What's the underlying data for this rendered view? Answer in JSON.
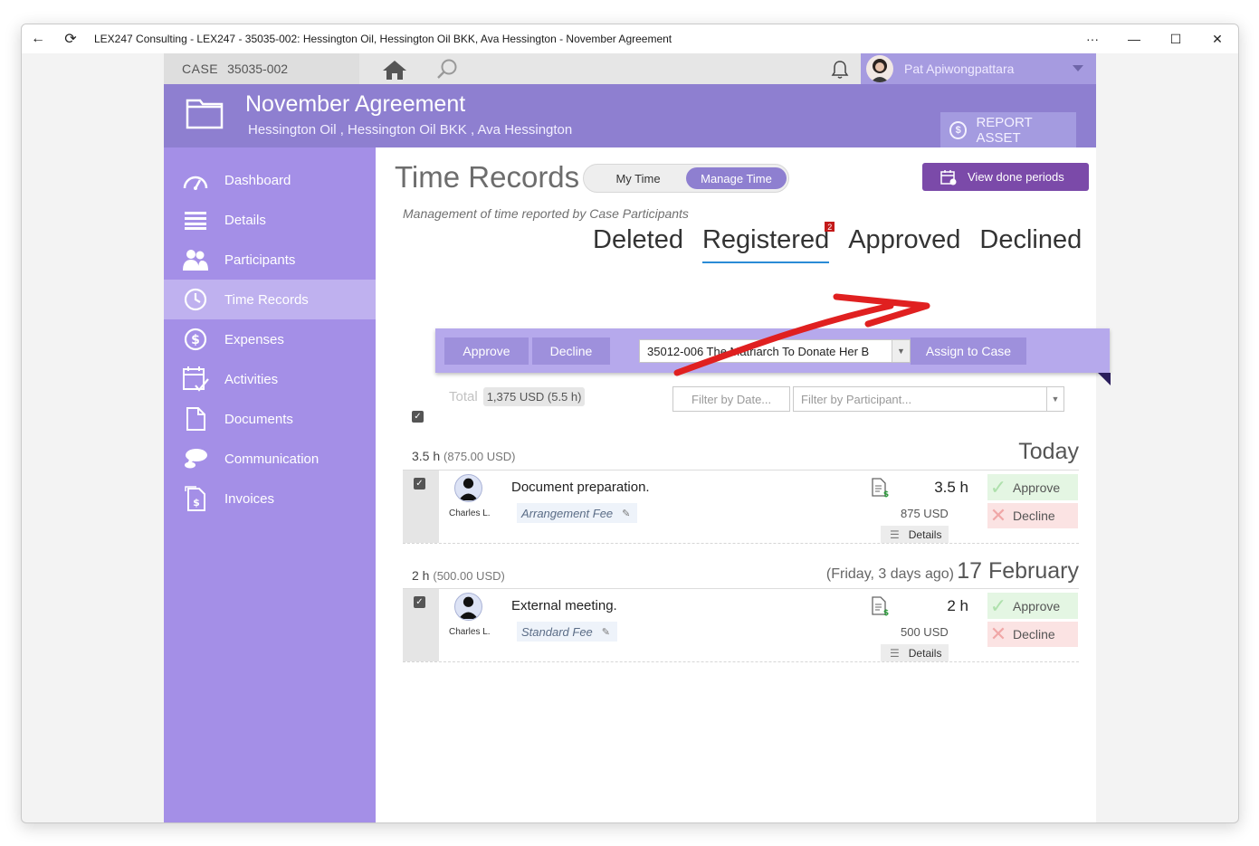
{
  "window": {
    "title": "LEX247 Consulting - LEX247 - 35035-002: Hessington Oil, Hessington Oil BKK, Ava Hessington - November Agreement",
    "more_label": "···"
  },
  "topbar": {
    "case_label": "CASE",
    "case_number": "35035-002",
    "user_name": "Pat Apiwongpattara"
  },
  "header": {
    "title": "November Agreement",
    "subtitle": "Hessington Oil ,  Hessington Oil BKK ,  Ava Hessington",
    "report_asset_label": "REPORT ASSET"
  },
  "sidebar": {
    "items": [
      {
        "label": "Dashboard",
        "icon": "dashboard-icon"
      },
      {
        "label": "Details",
        "icon": "list-icon"
      },
      {
        "label": "Participants",
        "icon": "people-icon"
      },
      {
        "label": "Time Records",
        "icon": "clock-icon",
        "active": true
      },
      {
        "label": "Expenses",
        "icon": "dollar-icon"
      },
      {
        "label": "Activities",
        "icon": "calendar-check-icon"
      },
      {
        "label": "Documents",
        "icon": "document-icon"
      },
      {
        "label": "Communication",
        "icon": "chat-icon"
      },
      {
        "label": "Invoices",
        "icon": "invoice-icon"
      }
    ]
  },
  "main": {
    "title": "Time Records",
    "toggle": {
      "my_time": "My Time",
      "manage_time": "Manage Time",
      "selected": "Manage Time"
    },
    "view_done_label": "View done periods",
    "subtitle": "Management of time reported by Case Participants",
    "status_tabs": [
      {
        "label": "Deleted"
      },
      {
        "label": "Registered",
        "badge": "2",
        "active": true
      },
      {
        "label": "Approved"
      },
      {
        "label": "Declined"
      }
    ],
    "action_bar": {
      "approve_label": "Approve",
      "decline_label": "Decline",
      "case_select_value": "35012-006 The Matriarch To Donate Her B",
      "assign_label": "Assign to Case"
    },
    "total_label": "Total",
    "total_value": "1,375 USD (5.5 h)",
    "filter_date_placeholder": "Filter by Date...",
    "filter_participant_placeholder": "Filter by Participant...",
    "groups": [
      {
        "hours": "3.5 h",
        "amount": "(875.00 USD)",
        "date": "Today",
        "relative": "",
        "record": {
          "person": "Charles L.",
          "description": "Document preparation.",
          "fee": "Arrangement Fee",
          "hours": "3.5 h",
          "amount": "875 USD",
          "details_label": "Details",
          "approve_label": "Approve",
          "decline_label": "Decline"
        }
      },
      {
        "hours": "2 h",
        "amount": "(500.00 USD)",
        "date": "17 February",
        "relative": "(Friday, 3 days ago)",
        "record": {
          "person": "Charles L.",
          "description": "External meeting.",
          "fee": "Standard Fee",
          "hours": "2 h",
          "amount": "500 USD",
          "details_label": "Details",
          "approve_label": "Approve",
          "decline_label": "Decline"
        }
      }
    ]
  },
  "colors": {
    "header_purple": "#8e7fd0",
    "sidebar_purple": "#a48fe7",
    "done_button": "#7b4aa9",
    "tab_underline": "#2a8bd6",
    "annotation_arrow": "#e02020"
  }
}
